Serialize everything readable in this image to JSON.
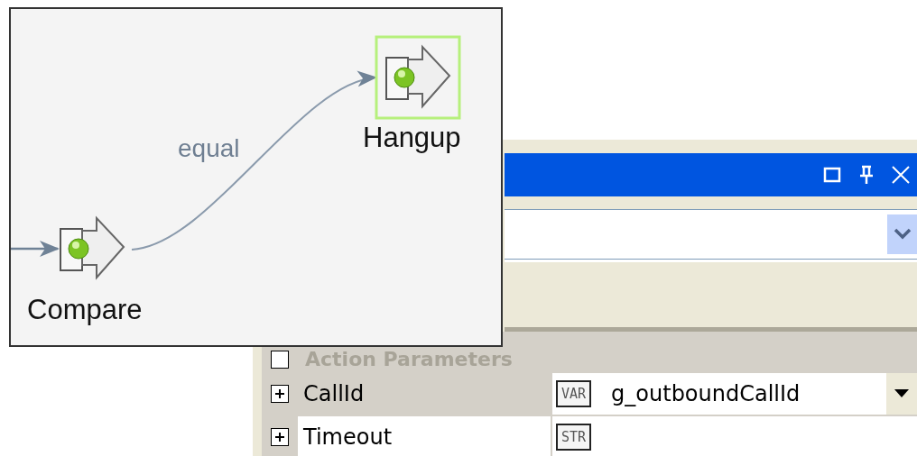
{
  "diagram": {
    "nodes": [
      {
        "label": "Compare",
        "selected": false
      },
      {
        "label": "Hangup",
        "selected": true
      }
    ],
    "edges": [
      {
        "label": "equal"
      }
    ]
  },
  "properties": {
    "category": {
      "label": "Action Parameters"
    },
    "rows": [
      {
        "name": "CallId",
        "type": "VAR",
        "value": "g_outboundCallId",
        "selected": true,
        "expanded": false
      },
      {
        "name": "Timeout",
        "type": "STR",
        "selected": false,
        "expanded": false
      }
    ]
  }
}
